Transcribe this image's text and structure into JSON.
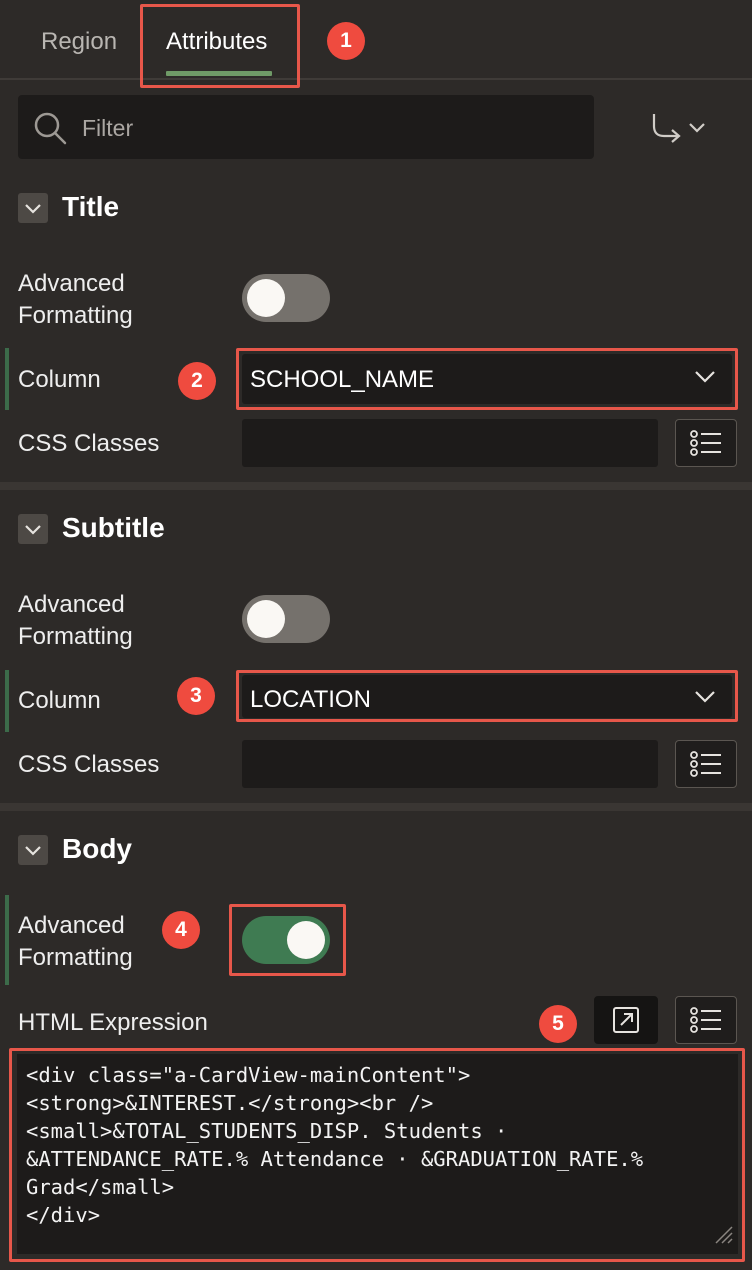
{
  "tabs": [
    {
      "label": "Region"
    },
    {
      "label": "Attributes"
    }
  ],
  "active_tab": "Attributes",
  "filter": {
    "placeholder": "Filter"
  },
  "badges": [
    "1",
    "2",
    "3",
    "4",
    "5"
  ],
  "sections": {
    "title": {
      "heading": "Title",
      "advanced_formatting_label": "Advanced\nFormatting",
      "advanced_formatting_on": false,
      "column_label": "Column",
      "column_value": "SCHOOL_NAME",
      "css_classes_label": "CSS Classes",
      "css_classes_value": ""
    },
    "subtitle": {
      "heading": "Subtitle",
      "advanced_formatting_label": "Advanced\nFormatting",
      "advanced_formatting_on": false,
      "column_label": "Column",
      "column_value": "LOCATION",
      "css_classes_label": "CSS Classes",
      "css_classes_value": ""
    },
    "body": {
      "heading": "Body",
      "advanced_formatting_label": "Advanced\nFormatting",
      "advanced_formatting_on": true,
      "html_expression_label": "HTML Expression",
      "html_expression_value": "<div class=\"a-CardView-mainContent\">\n<strong>&INTEREST.</strong><br />\n<small>&TOTAL_STUDENTS_DISP. Students ·\n&ATTENDANCE_RATE.% Attendance · &GRADUATION_RATE.%\nGrad</small>\n</div>"
    }
  },
  "colors": {
    "highlight": "#e7574a",
    "badge": "#ef4b3f",
    "toggle_on": "#3f7b52",
    "active_tab_underline": "#6f9a67"
  },
  "icons": [
    "search-icon",
    "go-to-arrow-icon",
    "chevron-down-icon",
    "list-icon",
    "expand-editor-icon",
    "resize-grip-icon"
  ]
}
